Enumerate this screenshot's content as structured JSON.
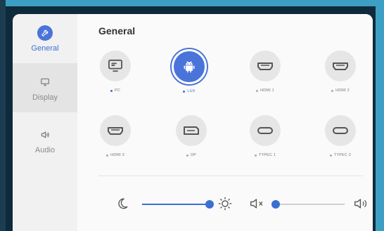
{
  "sidebar": {
    "items": [
      {
        "label": "General",
        "icon": "wrench-icon",
        "active": true
      },
      {
        "label": "Display",
        "icon": "monitor-icon",
        "active": false
      },
      {
        "label": "Audio",
        "icon": "speaker-icon",
        "active": false
      }
    ]
  },
  "main": {
    "title": "General",
    "sources": [
      {
        "label": "PC",
        "icon": "pc-icon",
        "selected": false
      },
      {
        "label": "LUX",
        "icon": "android-icon",
        "selected": true
      },
      {
        "label": "HDMI 1",
        "icon": "hdmi-port-icon",
        "selected": false
      },
      {
        "label": "HDMI 2",
        "icon": "hdmi-port-icon",
        "selected": false
      },
      {
        "label": "HDMI 3",
        "icon": "hdmi-port-icon",
        "selected": false
      },
      {
        "label": "DP",
        "icon": "displayport-icon",
        "selected": false
      },
      {
        "label": "TYPEC 1",
        "icon": "usb-c-icon",
        "selected": false
      },
      {
        "label": "TYPEC 2",
        "icon": "usb-c-icon",
        "selected": false
      }
    ],
    "brightness": {
      "level": 0.96,
      "min_icon": "moon-icon",
      "max_icon": "sun-icon"
    },
    "volume": {
      "level": 0.0,
      "min_icon": "mute-icon",
      "max_icon": "speaker-loud-icon"
    }
  },
  "colors": {
    "accent": "#4a74d9",
    "background": "#f1f1f1",
    "frame": "#3d9fc4"
  }
}
